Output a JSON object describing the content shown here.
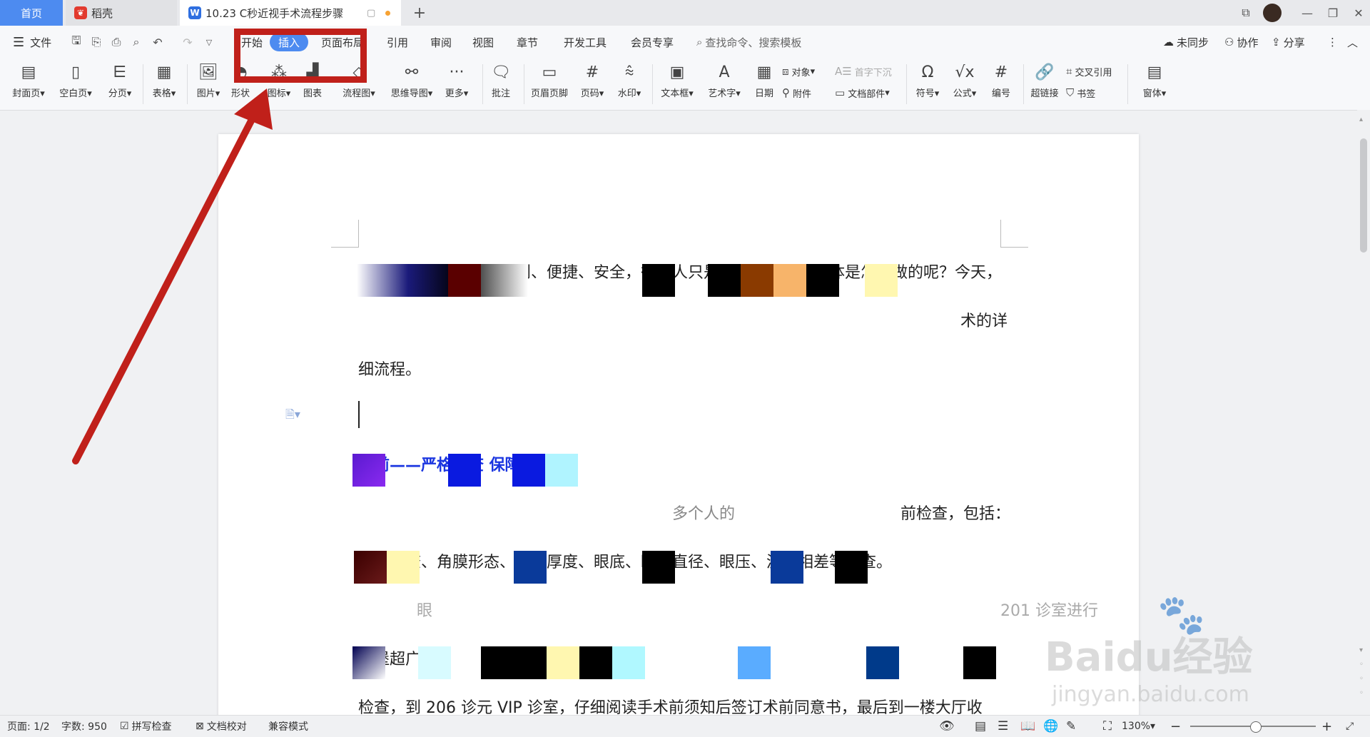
{
  "tabs": {
    "home": "首页",
    "daoke": "稻壳",
    "document": "10.23 C秒近视手术流程步骤"
  },
  "menu": {
    "file": "文件",
    "start": "开始",
    "insert": "插入",
    "page_layout": "页面布局",
    "reference": "引用",
    "review": "审阅",
    "view": "视图",
    "chapter": "章节",
    "dev_tools": "开发工具",
    "member": "会员专享",
    "search_placeholder": "查找命令、搜索模板",
    "unsynced": "未同步",
    "collaborate": "协作",
    "share": "分享"
  },
  "toolbar": {
    "cover": "封面页",
    "blank_page": "空白页",
    "page_break": "分页",
    "table": "表格",
    "picture": "图片",
    "shape": "形状",
    "icon": "图标",
    "chart": "图表",
    "flowchart": "流程图",
    "mindmap": "思维导图",
    "more": "更多",
    "comment": "批注",
    "header_footer": "页眉页脚",
    "page_number": "页码",
    "watermark": "水印",
    "textbox": "文本框",
    "wordart": "艺术字",
    "date": "日期",
    "object": "对象",
    "attachment": "附件",
    "drop_cap": "首字下沉",
    "doc_parts": "文档部件",
    "symbol": "符号",
    "formula": "公式",
    "numbering": "编号",
    "hyperlink": "超链接",
    "cross_ref": "交叉引用",
    "bookmark": "书签",
    "form": "窗体"
  },
  "document": {
    "line1": "都说全飞秒近视手术微创、便捷、安全，很多人只是听说过，但是具体是怎么做的呢？今天，",
    "line2_end": "术的详",
    "line3": "细流程。",
    "heading": "术前——严格检查 保障安全",
    "line5_mid": "多个人的",
    "line5_end": "前检查，包括：",
    "line6": "眼压检查、角膜形态、角膜厚度、眼底、瞳孔直径、眼压、波前相差等检查。",
    "line7_mid": "眼",
    "line7_end": "201 诊室进行",
    "line8": "欧堡超广角",
    "line9": "检查，到 206 诊元 VIP 诊室，仔细阅读手术前须知后签订术前同意书，最后到一楼大厅收"
  },
  "status": {
    "page": "页面: 1/2",
    "words": "字数: 950",
    "spell": "拼写检查",
    "proof": "文档校对",
    "compat": "兼容模式",
    "zoom": "130%"
  },
  "watermark": {
    "brand": "Baidu经验",
    "url": "jingyan.baidu.com"
  },
  "colors": {
    "accent": "#4d8bf0",
    "annotation": "#c0201a",
    "heading_blue": "#1a35e0"
  }
}
